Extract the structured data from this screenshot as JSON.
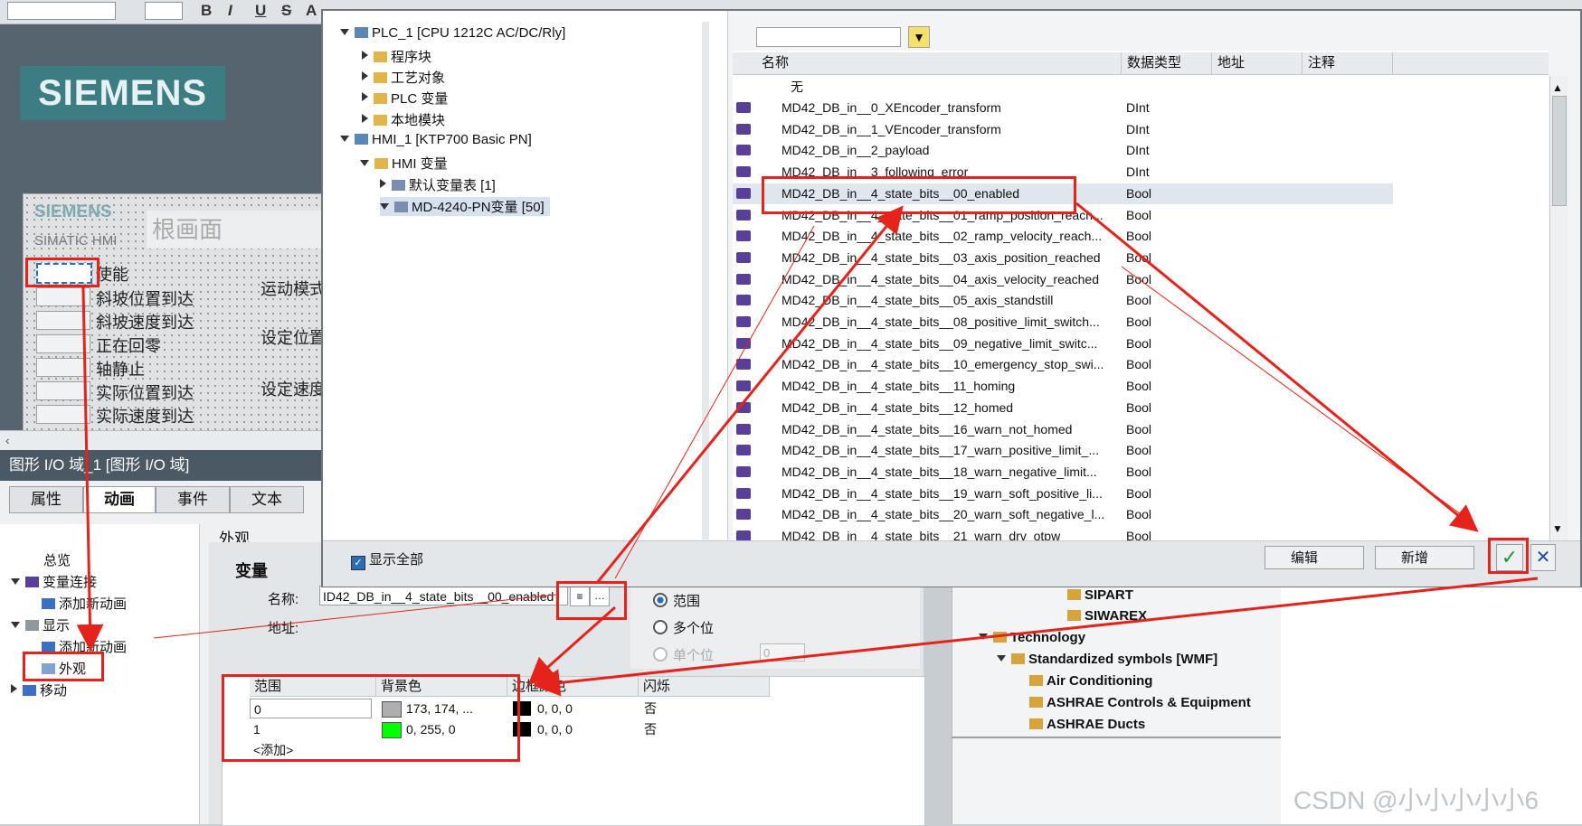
{
  "toolbar": {
    "bold": "B",
    "italic": "I",
    "underline": "U",
    "strike": "S",
    "font_a": "A"
  },
  "canvas": {
    "logo": "SIEMENS",
    "screen_brand": "SIEMENS",
    "screen_sub": "SIMATIC HMI",
    "screen_title": "根画面",
    "io_labels": [
      "使能",
      "斜坡位置到达",
      "斜坡速度到达",
      "正在回零",
      "轴静止",
      "实际位置到达",
      "实际速度到达"
    ],
    "mid_labels": [
      "运动模式",
      "设定位置",
      "设定速度"
    ]
  },
  "inspector": {
    "title": "图形 I/O 域_1 [图形 I/O 域]",
    "tabs": [
      "属性",
      "动画",
      "事件",
      "文本"
    ],
    "tree": {
      "overview": "总览",
      "var_link": "变量连接",
      "add_anim_1": "添加新动画",
      "display": "显示",
      "add_anim_2": "添加新动画",
      "appearance": "外观",
      "move": "移动"
    },
    "section_title": "外观",
    "variable_heading": "变量",
    "name_label": "名称:",
    "name_value": "ID42_DB_in__4_state_bits__00_enabled",
    "address_label": "地址:",
    "type_options": [
      "范围",
      "多个位",
      "单个位"
    ],
    "bit_value": "0"
  },
  "grid": {
    "headers": [
      "范围",
      "背景色",
      "边框颜色",
      "闪烁"
    ],
    "rows": [
      {
        "range": "0",
        "bg": "173, 174, ...",
        "border": "0, 0, 0",
        "blink": "否",
        "bg_color": "#adaeb0"
      },
      {
        "range": "1",
        "bg": "0, 255, 0",
        "border": "0, 0, 0",
        "blink": "否",
        "bg_color": "#00ff00"
      }
    ],
    "add_label": "<添加>"
  },
  "library": {
    "items": [
      "SIPART",
      "SIWAREX",
      "Technology",
      "Standardized symbols [WMF]",
      "Air Conditioning",
      "ASHRAE Controls & Equipment",
      "ASHRAE Ducts"
    ]
  },
  "dialog": {
    "tree": [
      {
        "label": "PLC_1 [CPU 1212C AC/DC/Rly]",
        "level": 0,
        "open": true
      },
      {
        "label": "程序块",
        "level": 1,
        "open": false
      },
      {
        "label": "工艺对象",
        "level": 1,
        "open": false
      },
      {
        "label": "PLC 变量",
        "level": 1,
        "open": false
      },
      {
        "label": "本地模块",
        "level": 1,
        "open": false
      },
      {
        "label": "HMI_1 [KTP700 Basic PN]",
        "level": 0,
        "open": true
      },
      {
        "label": "HMI 变量",
        "level": 1,
        "open": true
      },
      {
        "label": "默认变量表 [1]",
        "level": 2,
        "open": false
      },
      {
        "label": "MD-4240-PN变量 [50]",
        "level": 2,
        "open": true
      }
    ],
    "filter_value": "",
    "columns": [
      "名称",
      "数据类型",
      "地址",
      "注释"
    ],
    "none_label": "无",
    "rows": [
      {
        "name": "MD42_DB_in__0_XEncoder_transform",
        "type": "DInt"
      },
      {
        "name": "MD42_DB_in__1_VEncoder_transform",
        "type": "DInt"
      },
      {
        "name": "MD42_DB_in__2_payload",
        "type": "DInt"
      },
      {
        "name": "MD42_DB_in__3_following_error",
        "type": "DInt"
      },
      {
        "name": "MD42_DB_in__4_state_bits__00_enabled",
        "type": "Bool"
      },
      {
        "name": "MD42_DB_in__4_state_bits__01_ramp_position_reach...",
        "type": "Bool"
      },
      {
        "name": "MD42_DB_in__4_state_bits__02_ramp_velocity_reach...",
        "type": "Bool"
      },
      {
        "name": "MD42_DB_in__4_state_bits__03_axis_position_reached",
        "type": "Bool"
      },
      {
        "name": "MD42_DB_in__4_state_bits__04_axis_velocity_reached",
        "type": "Bool"
      },
      {
        "name": "MD42_DB_in__4_state_bits__05_axis_standstill",
        "type": "Bool"
      },
      {
        "name": "MD42_DB_in__4_state_bits__08_positive_limit_switch...",
        "type": "Bool"
      },
      {
        "name": "MD42_DB_in__4_state_bits__09_negative_limit_switc...",
        "type": "Bool"
      },
      {
        "name": "MD42_DB_in__4_state_bits__10_emergency_stop_swi...",
        "type": "Bool"
      },
      {
        "name": "MD42_DB_in__4_state_bits__11_homing",
        "type": "Bool"
      },
      {
        "name": "MD42_DB_in__4_state_bits__12_homed",
        "type": "Bool"
      },
      {
        "name": "MD42_DB_in__4_state_bits__16_warn_not_homed",
        "type": "Bool"
      },
      {
        "name": "MD42_DB_in__4_state_bits__17_warn_positive_limit_...",
        "type": "Bool"
      },
      {
        "name": "MD42_DB_in__4_state_bits__18_warn_negative_limit...",
        "type": "Bool"
      },
      {
        "name": "MD42_DB_in__4_state_bits__19_warn_soft_positive_li...",
        "type": "Bool"
      },
      {
        "name": "MD42_DB_in__4_state_bits__20_warn_soft_negative_l...",
        "type": "Bool"
      },
      {
        "name": "MD42_DB_in__4_state_bits__21_warn_drv_otpw",
        "type": "Bool"
      }
    ],
    "show_all": "显示全部",
    "edit": "编辑",
    "new": "新增"
  },
  "watermark": "CSDN @小小小小小6",
  "colors": {
    "accent_red": "#e5231b",
    "siemens_teal": "#3b7d82",
    "tag_icon": "#5a3f99"
  }
}
